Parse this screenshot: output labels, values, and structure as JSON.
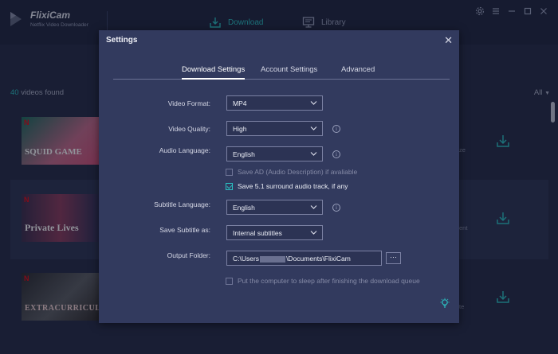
{
  "app": {
    "name": "FlixiCam",
    "subtitle": "Netflix Video Downloader"
  },
  "nav": {
    "download": "Download",
    "library": "Library"
  },
  "list": {
    "count": "40",
    "count_suffix": " videos found",
    "filter": "All",
    "items": [
      {
        "thumb_title": "SQUID GAME",
        "side_text": "ze"
      },
      {
        "thumb_title": "Private Lives",
        "side_text": "ent"
      },
      {
        "thumb_title": "EXTRACURRICULAR",
        "side_text": "te"
      }
    ]
  },
  "settings": {
    "title": "Settings",
    "tabs": [
      "Download Settings",
      "Account Settings",
      "Advanced"
    ],
    "active_tab": "Download Settings",
    "video_format": {
      "label": "Video Format:",
      "value": "MP4"
    },
    "video_quality": {
      "label": "Video Quality:",
      "value": "High"
    },
    "audio_language": {
      "label": "Audio Language:",
      "value": "English"
    },
    "save_ad": {
      "label": "Save AD (Audio Description) if avaliable",
      "checked": false
    },
    "save_51": {
      "label": "Save 5.1 surround audio track, if any",
      "checked": true
    },
    "subtitle_language": {
      "label": "Subtitle Language:",
      "value": "English"
    },
    "save_subtitle_as": {
      "label": "Save Subtitle as:",
      "value": "Internal subtitles"
    },
    "output_folder": {
      "label": "Output Folder:",
      "path_prefix": "C:\\Users",
      "path_suffix": "\\Documents\\FlixiCam",
      "browse": "···"
    },
    "sleep_option": {
      "label": "Put the computer to sleep after finishing the download queue",
      "checked": false
    }
  },
  "colors": {
    "accent": "#2bc0c2",
    "background": "#252b45",
    "modal": "#323a5e"
  },
  "icons": [
    "download-tray-icon",
    "monitor-icon",
    "gear-icon",
    "menu-icon",
    "minimize-icon",
    "maximize-icon",
    "close-icon",
    "chevron-down-icon",
    "info-icon",
    "lightbulb-icon"
  ]
}
